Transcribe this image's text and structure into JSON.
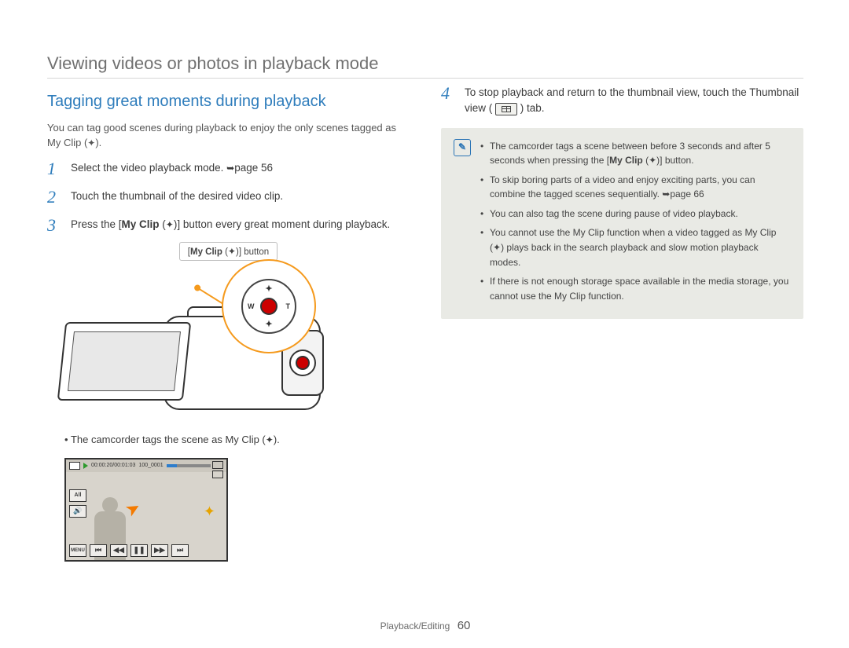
{
  "header": {
    "title": "Viewing videos or photos in playback mode"
  },
  "left": {
    "section_title": "Tagging great moments during playback",
    "intro_a": "You can tag good scenes during playback to enjoy the only scenes tagged as My Clip (",
    "intro_b": ").",
    "steps": {
      "s1": {
        "num": "1",
        "text_a": "Select the video playback mode. ",
        "arrow": "➥",
        "page_ref": "page 56"
      },
      "s2": {
        "num": "2",
        "text": "Touch the thumbnail of the desired video clip."
      },
      "s3": {
        "num": "3",
        "text_a": "Press the [",
        "my_clip": "My Clip",
        "text_b": " (",
        "text_c": ")] button every great moment during playback."
      },
      "s4": {
        "num": "4",
        "text_a": "To stop playback and return to the thumbnail view, touch the Thumbnail view (",
        "text_b": ") tab."
      }
    },
    "callout": {
      "label_a": "[",
      "my_clip": "My Clip",
      "label_b": " (",
      "label_c": ")] button"
    },
    "dpad": {
      "w": "W",
      "t": "T"
    },
    "bullet": {
      "text_a": "The camcorder tags the scene as My Clip (",
      "text_b": ")."
    },
    "playback_screen": {
      "timecode": "00:00:20/00:01:03",
      "clip_name": "100_0001",
      "side": {
        "all": "All",
        "vol": "🔊",
        "menu": "MENU"
      },
      "controls": {
        "prev": "⏮",
        "rw": "◀◀",
        "pause": "❚❚",
        "ff": "▶▶",
        "next": "⏭"
      }
    }
  },
  "right": {
    "notes": {
      "n1_a": "The camcorder tags a scene between before 3 seconds and after 5 seconds when pressing the [",
      "n1_my_clip": "My Clip",
      "n1_b": " (",
      "n1_c": ")] button.",
      "n2_a": "To skip boring parts of a video and enjoy exciting parts, you can combine the tagged scenes sequentially. ",
      "n2_arrow": "➥",
      "n2_page": "page 66",
      "n3": "You can also tag the scene during pause of video playback.",
      "n4_a": "You cannot use the My Clip function when a video tagged as My Clip (",
      "n4_b": ") plays back in the search playback and slow motion playback modes.",
      "n5": "If there is not enough storage space available in the media storage, you cannot use the My Clip function."
    }
  },
  "footer": {
    "section": "Playback/Editing",
    "page": "60"
  },
  "glyphs": {
    "myclip": "✦"
  }
}
